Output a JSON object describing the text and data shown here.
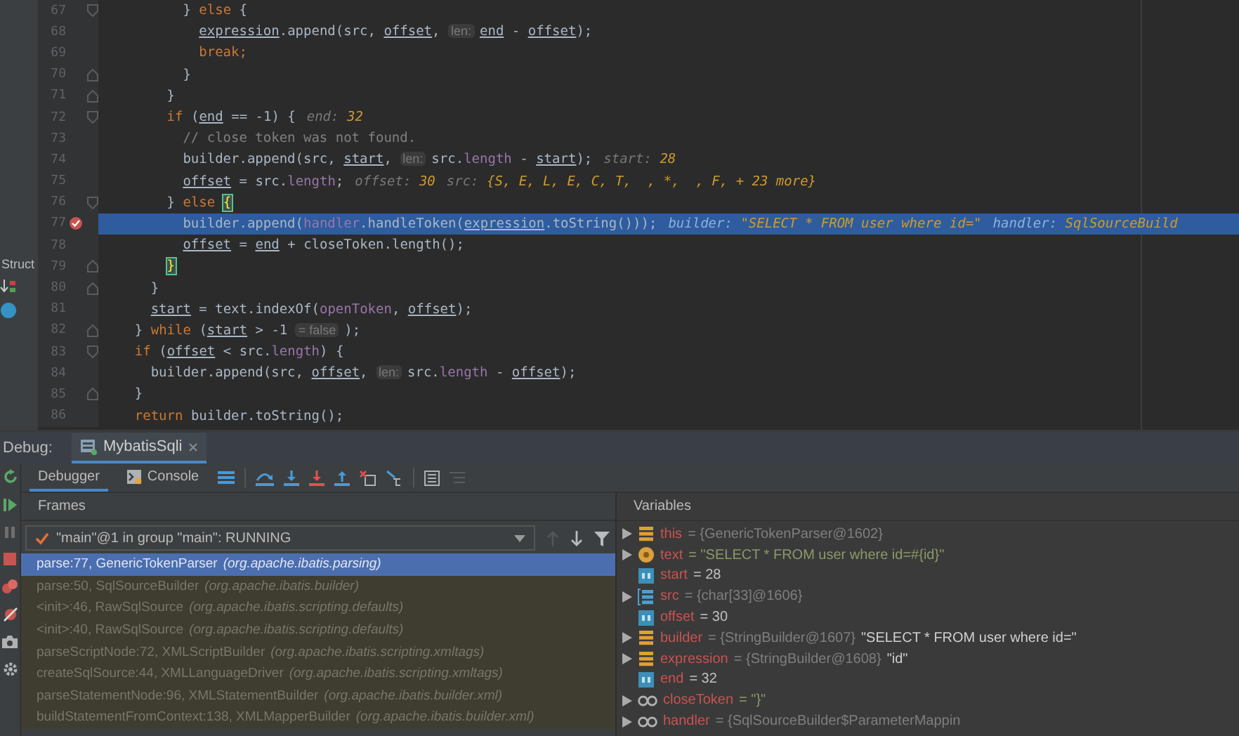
{
  "editor": {
    "side_panel": {
      "label": "Struct"
    },
    "lines": [
      {
        "number": "67",
        "fold": {
          "kind": "open"
        },
        "breakpoint": false,
        "current": false,
        "code": [
          {
            "kind": "t",
            "text": "          } "
          },
          {
            "kind": "kw",
            "text": "else"
          },
          {
            "kind": "t",
            "text": " {"
          }
        ]
      },
      {
        "number": "68",
        "breakpoint": false,
        "current": false,
        "code": [
          {
            "kind": "u",
            "text": "            expression"
          },
          {
            "kind": "t",
            "text": ".append(src, "
          },
          {
            "kind": "u",
            "text": "offset"
          },
          {
            "kind": "t",
            "text": ", "
          },
          {
            "kind": "p",
            "text": "len:"
          },
          {
            "kind": "u",
            "text": "end"
          },
          {
            "kind": "t",
            "text": " - "
          },
          {
            "kind": "u",
            "text": "offset"
          },
          {
            "kind": "t",
            "text": ");"
          }
        ]
      },
      {
        "number": "69",
        "breakpoint": false,
        "current": false,
        "code": [
          {
            "kind": "kw",
            "text": "            break;"
          }
        ]
      },
      {
        "number": "70",
        "fold": {
          "kind": "close"
        },
        "breakpoint": false,
        "current": false,
        "code": [
          {
            "kind": "t",
            "text": "          }"
          }
        ]
      },
      {
        "number": "71",
        "fold": {
          "kind": "close"
        },
        "breakpoint": false,
        "current": false,
        "code": [
          {
            "kind": "t",
            "text": "        }"
          }
        ]
      },
      {
        "number": "72",
        "fold": {
          "kind": "open"
        },
        "breakpoint": false,
        "current": false,
        "code": [
          {
            "kind": "kw",
            "text": "        if"
          },
          {
            "kind": "t",
            "text": " ("
          },
          {
            "kind": "u",
            "text": "end"
          },
          {
            "kind": "t",
            "text": " == -1) {"
          }
        ],
        "hints": [
          {
            "label": "end:",
            "value": "32"
          }
        ]
      },
      {
        "number": "73",
        "breakpoint": false,
        "current": false,
        "code": [
          {
            "kind": "c",
            "text": "          // close token was not found."
          }
        ]
      },
      {
        "number": "74",
        "breakpoint": false,
        "current": false,
        "code": [
          {
            "kind": "t",
            "text": "          builder.append(src, "
          },
          {
            "kind": "u",
            "text": "start"
          },
          {
            "kind": "t",
            "text": ", "
          },
          {
            "kind": "p",
            "text": "len:"
          },
          {
            "kind": "t",
            "text": "src."
          },
          {
            "kind": "f",
            "text": "length"
          },
          {
            "kind": "t",
            "text": " - "
          },
          {
            "kind": "u",
            "text": "start"
          },
          {
            "kind": "t",
            "text": ");"
          }
        ],
        "hints": [
          {
            "label": "start:",
            "value": "28"
          }
        ]
      },
      {
        "number": "75",
        "breakpoint": false,
        "current": false,
        "code": [
          {
            "kind": "u",
            "text": "          offset"
          },
          {
            "kind": "t",
            "text": " = src."
          },
          {
            "kind": "f",
            "text": "length"
          },
          {
            "kind": "t",
            "text": ";"
          }
        ],
        "hints": [
          {
            "label": "offset:",
            "value": "30"
          },
          {
            "label": "src:",
            "value": "{S, E, L, E, C, T,  , *,  , F, + 23 more}"
          }
        ]
      },
      {
        "number": "76",
        "fold": {
          "kind": "open"
        },
        "breakpoint": false,
        "current": false,
        "code": [
          {
            "kind": "t",
            "text": "        } "
          },
          {
            "kind": "kw",
            "text": "else"
          },
          {
            "kind": "m",
            "text": " {"
          }
        ]
      },
      {
        "number": "77",
        "breakpoint": true,
        "current": true,
        "code": [
          {
            "kind": "t",
            "text": "          builder.append("
          },
          {
            "kind": "f",
            "text": "handler"
          },
          {
            "kind": "t",
            "text": ".handleToken("
          },
          {
            "kind": "u",
            "text": "expression"
          },
          {
            "kind": "t",
            "text": ".toString()));"
          }
        ],
        "hints": [
          {
            "label": "builder:",
            "value": "\"SELECT * FROM user where id=\""
          },
          {
            "label": "handler:",
            "value": "SqlSourceBuild"
          }
        ]
      },
      {
        "number": "78",
        "breakpoint": false,
        "current": false,
        "code": [
          {
            "kind": "u",
            "text": "          offset"
          },
          {
            "kind": "t",
            "text": " = "
          },
          {
            "kind": "u",
            "text": "end"
          },
          {
            "kind": "t",
            "text": " + closeToken.length();"
          }
        ]
      },
      {
        "number": "79",
        "fold": {
          "kind": "close"
        },
        "breakpoint": false,
        "current": false,
        "code": [
          {
            "kind": "m",
            "text": "        }"
          }
        ]
      },
      {
        "number": "80",
        "fold": {
          "kind": "close"
        },
        "breakpoint": false,
        "current": false,
        "code": [
          {
            "kind": "t",
            "text": "      }"
          }
        ]
      },
      {
        "number": "81",
        "breakpoint": false,
        "current": false,
        "code": [
          {
            "kind": "u",
            "text": "      start"
          },
          {
            "kind": "t",
            "text": " = text.indexOf("
          },
          {
            "kind": "f",
            "text": "openToken"
          },
          {
            "kind": "t",
            "text": ", "
          },
          {
            "kind": "u",
            "text": "offset"
          },
          {
            "kind": "t",
            "text": ");"
          }
        ]
      },
      {
        "number": "82",
        "fold": {
          "kind": "close"
        },
        "breakpoint": false,
        "current": false,
        "code": [
          {
            "kind": "t",
            "text": "    } "
          },
          {
            "kind": "kw",
            "text": "while"
          },
          {
            "kind": "t",
            "text": " ("
          },
          {
            "kind": "u",
            "text": "start"
          },
          {
            "kind": "t",
            "text": " > -1 "
          },
          {
            "kind": "b",
            "text": "= false"
          },
          {
            "kind": "t",
            "text": ");"
          }
        ]
      },
      {
        "number": "83",
        "fold": {
          "kind": "open"
        },
        "breakpoint": false,
        "current": false,
        "code": [
          {
            "kind": "kw",
            "text": "    if"
          },
          {
            "kind": "t",
            "text": " ("
          },
          {
            "kind": "u",
            "text": "offset"
          },
          {
            "kind": "t",
            "text": " < src."
          },
          {
            "kind": "f",
            "text": "length"
          },
          {
            "kind": "t",
            "text": ") {"
          }
        ]
      },
      {
        "number": "84",
        "breakpoint": false,
        "current": false,
        "code": [
          {
            "kind": "t",
            "text": "      builder.append(src, "
          },
          {
            "kind": "u",
            "text": "offset"
          },
          {
            "kind": "t",
            "text": ", "
          },
          {
            "kind": "p",
            "text": "len:"
          },
          {
            "kind": "t",
            "text": "src."
          },
          {
            "kind": "f",
            "text": "length"
          },
          {
            "kind": "t",
            "text": " - "
          },
          {
            "kind": "u",
            "text": "offset"
          },
          {
            "kind": "t",
            "text": ");"
          }
        ]
      },
      {
        "number": "85",
        "fold": {
          "kind": "close"
        },
        "breakpoint": false,
        "current": false,
        "code": [
          {
            "kind": "t",
            "text": "    }"
          }
        ]
      },
      {
        "number": "86",
        "breakpoint": false,
        "current": false,
        "code": [
          {
            "kind": "kw",
            "text": "    return"
          },
          {
            "kind": "t",
            "text": " builder.toString();"
          }
        ]
      }
    ]
  },
  "debug": {
    "label": "Debug:",
    "session_tab": {
      "label": "MybatisSqli"
    },
    "tabs": [
      {
        "label": "Debugger",
        "selected": true
      },
      {
        "label": "Console",
        "selected": false
      }
    ],
    "frames": {
      "title": "Frames",
      "thread": "\"main\"@1 in group \"main\": RUNNING",
      "items": [
        {
          "method": "parse:77, GenericTokenParser",
          "package": "(org.apache.ibatis.parsing)",
          "selected": true
        },
        {
          "method": "parse:50, SqlSourceBuilder",
          "package": "(org.apache.ibatis.builder)",
          "selected": false
        },
        {
          "method": "<init>:46, RawSqlSource",
          "package": "(org.apache.ibatis.scripting.defaults)",
          "selected": false
        },
        {
          "method": "<init>:40, RawSqlSource",
          "package": "(org.apache.ibatis.scripting.defaults)",
          "selected": false
        },
        {
          "method": "parseScriptNode:72, XMLScriptBuilder",
          "package": "(org.apache.ibatis.scripting.xmltags)",
          "selected": false
        },
        {
          "method": "createSqlSource:44, XMLLanguageDriver",
          "package": "(org.apache.ibatis.scripting.xmltags)",
          "selected": false
        },
        {
          "method": "parseStatementNode:96, XMLStatementBuilder",
          "package": "(org.apache.ibatis.builder.xml)",
          "selected": false
        },
        {
          "method": "buildStatementFromContext:138, XMLMapperBuilder",
          "package": "(org.apache.ibatis.builder.xml)",
          "selected": false
        }
      ]
    },
    "variables": {
      "title": "Variables",
      "items": [
        {
          "expandable": true,
          "kind": "object",
          "name": "this",
          "value": {
            "kind": "ref",
            "text": "= {GenericTokenParser@1602}"
          }
        },
        {
          "expandable": true,
          "kind": "param",
          "name": "text",
          "value": {
            "kind": "string",
            "text": "= \"SELECT * FROM user where id=#{id}\""
          }
        },
        {
          "expandable": false,
          "kind": "primitive",
          "name": "start",
          "value": {
            "kind": "number",
            "text": "= 28"
          }
        },
        {
          "expandable": true,
          "kind": "array",
          "name": "src",
          "value": {
            "kind": "ref",
            "text": "= {char[33]@1606}"
          }
        },
        {
          "expandable": false,
          "kind": "primitive",
          "name": "offset",
          "value": {
            "kind": "number",
            "text": "= 30"
          }
        },
        {
          "expandable": true,
          "kind": "object",
          "name": "builder",
          "value": {
            "kind": "ref",
            "text": "= {StringBuilder@1607}"
          },
          "detail": "\"SELECT * FROM user where id=\""
        },
        {
          "expandable": true,
          "kind": "object",
          "name": "expression",
          "value": {
            "kind": "ref",
            "text": "= {StringBuilder@1608}"
          },
          "detail": "\"id\""
        },
        {
          "expandable": false,
          "kind": "primitive",
          "name": "end",
          "value": {
            "kind": "number",
            "text": "= 32"
          }
        },
        {
          "expandable": true,
          "kind": "watch",
          "name": "closeToken",
          "value": {
            "kind": "string",
            "text": "= \"}\""
          }
        },
        {
          "expandable": true,
          "kind": "watch",
          "name": "handler",
          "value": {
            "kind": "ref",
            "text": "= {SqlSourceBuilder$ParameterMappin"
          }
        }
      ]
    }
  }
}
